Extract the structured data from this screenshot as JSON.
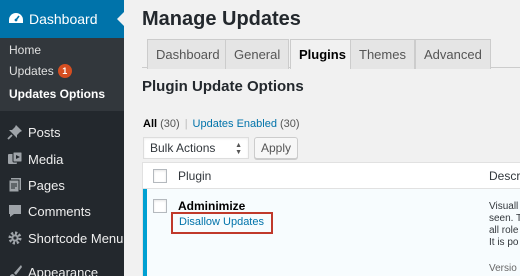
{
  "sidebar": {
    "active_menu": {
      "label": "Dashboard",
      "icon": "dashboard-icon"
    },
    "submenu": [
      {
        "label": "Home"
      },
      {
        "label": "Updates",
        "badge": "1"
      },
      {
        "label": "Updates Options",
        "current": true
      }
    ],
    "items": [
      {
        "label": "Posts",
        "icon": "pushpin-icon"
      },
      {
        "label": "Media",
        "icon": "media-icon"
      },
      {
        "label": "Pages",
        "icon": "pages-icon"
      },
      {
        "label": "Comments",
        "icon": "comments-icon"
      },
      {
        "label": "Shortcode Menu",
        "icon": "gear-icon"
      },
      {
        "label": "Appearance",
        "icon": "brush-icon"
      }
    ]
  },
  "main": {
    "title": "Manage Updates",
    "tabs": [
      {
        "label": "Dashboard"
      },
      {
        "label": "General"
      },
      {
        "label": "Plugins",
        "active": true
      },
      {
        "label": "Themes"
      },
      {
        "label": "Advanced"
      }
    ],
    "section_title": "Plugin Update Options",
    "filters": {
      "all_label": "All",
      "all_count": "(30)",
      "separator": "|",
      "enabled_label": "Updates Enabled",
      "enabled_count": "(30)"
    },
    "bulk_actions": {
      "selected": "Bulk Actions",
      "apply_label": "Apply"
    },
    "table": {
      "columns": [
        "Plugin",
        "Descr"
      ],
      "rows": [
        {
          "name": "Adminimize",
          "action": "Disallow Updates",
          "description_lines": [
            "Visuall",
            "seen. T",
            "all role",
            "It is po"
          ],
          "version": "Versio"
        }
      ]
    }
  },
  "colors": {
    "sidebar_bg": "#23282d",
    "submenu_bg": "#32373c",
    "accent_blue": "#0073aa",
    "badge_orange": "#d54e21",
    "highlight_red": "#c0392b",
    "row_accent": "#00a0d2"
  }
}
